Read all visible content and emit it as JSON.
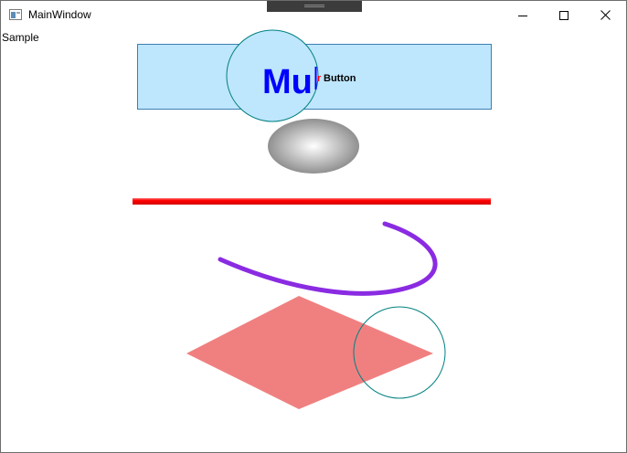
{
  "window": {
    "title": "MainWindow",
    "icon": "app-window-icon",
    "controls": [
      "minimize-icon",
      "maximize-icon",
      "close-icon"
    ]
  },
  "content": {
    "label": "Sample",
    "button": {
      "big_text": "Mu",
      "red_text": "r",
      "caption": "Button"
    }
  },
  "colors": {
    "button_fill": "#bee6fd",
    "button_border": "#3c7fb1",
    "big_text": "#0000ff",
    "red_line": "#ff0000",
    "purple_curve": "#8a2be2",
    "diamond": "#f08080",
    "circle_stroke": "#008080"
  }
}
